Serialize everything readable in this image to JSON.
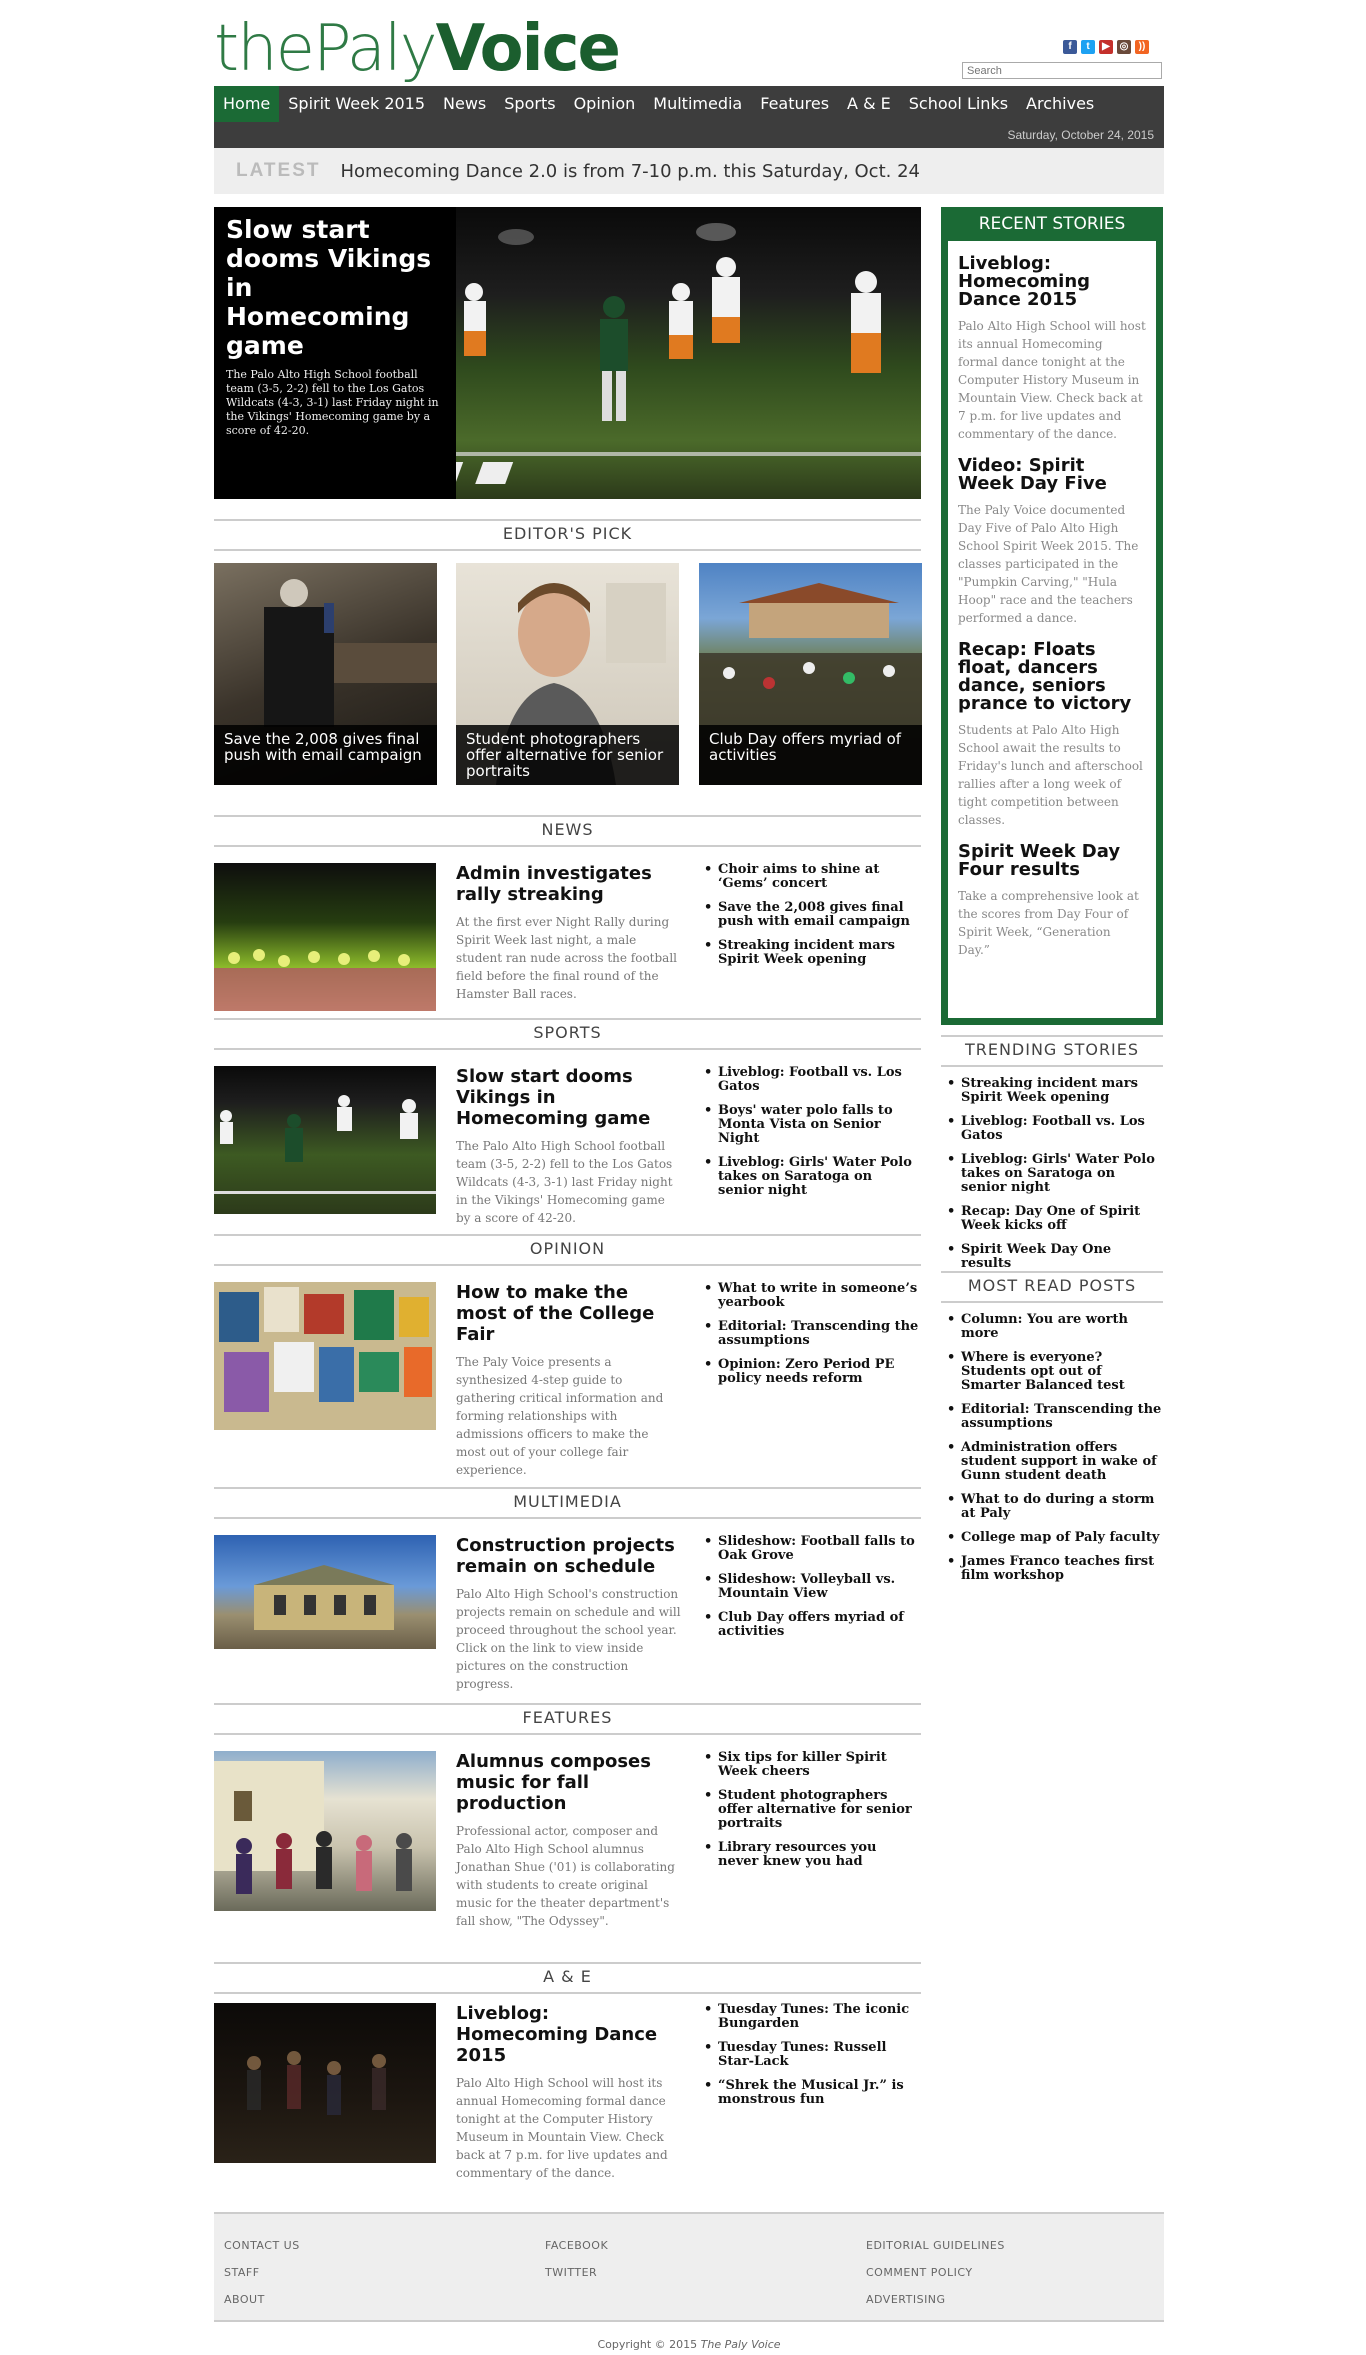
{
  "header": {
    "logo_part1": "thePaly",
    "logo_part2": "Voice",
    "search_placeholder": "Search",
    "social_icons": [
      "facebook-icon",
      "twitter-icon",
      "youtube-icon",
      "instagram-icon",
      "rss-icon"
    ]
  },
  "nav": {
    "items": [
      "Home",
      "Spirit Week 2015",
      "News",
      "Sports",
      "Opinion",
      "Multimedia",
      "Features",
      "A & E",
      "School Links",
      "Archives"
    ],
    "active": "Home",
    "date": "Saturday, October 24, 2015"
  },
  "latest": {
    "label": "LATEST",
    "text": "Homecoming Dance 2.0 is from 7-10 p.m. this Saturday, Oct. 24"
  },
  "hero": {
    "title": "Slow start dooms Vikings in Homecoming game",
    "summary": "The Palo Alto High School football team (3-5, 2-2) fell to the Los Gatos Wildcats (4-3, 3-1) last Friday night in the Vikings' Homecoming game by a score of 42-20."
  },
  "editors_pick": {
    "heading": "EDITOR'S PICK",
    "items": [
      "Save the 2,008 gives final push with email campaign",
      "Student photographers offer alternative for senior portraits",
      "Club Day offers myriad of activities"
    ]
  },
  "sections": [
    {
      "heading": "NEWS",
      "title": "Admin investigates rally streaking",
      "summary": "At the first ever Night Rally during Spirit Week last night, a male student ran nude across the football field before the final round of the Hamster Ball races.",
      "links": [
        "Choir aims to shine at ‘Gems’ concert",
        "Save the 2,008 gives final push with email campaign",
        "Streaking incident mars Spirit Week opening"
      ]
    },
    {
      "heading": "SPORTS",
      "title": "Slow start dooms Vikings in Homecoming game",
      "summary": "The Palo Alto High School football team (3-5, 2-2) fell to the Los Gatos Wildcats (4-3, 3-1) last Friday night in the Vikings' Homecoming game by a score of 42-20.",
      "links": [
        "Liveblog: Football vs. Los Gatos",
        "Boys' water polo falls to Monta Vista on Senior Night",
        "Liveblog: Girls' Water Polo takes on Saratoga on senior night"
      ]
    },
    {
      "heading": "OPINION",
      "title": "How to make the most of the College Fair",
      "summary": "The Paly Voice presents a synthesized 4-step guide to gathering critical information and forming relationships with admissions officers to make the most out of your college fair experience.",
      "links": [
        "What to write in someone’s yearbook",
        "Editorial: Transcending the assumptions",
        "Opinion: Zero Period PE policy needs reform"
      ]
    },
    {
      "heading": "MULTIMEDIA",
      "title": "Construction projects remain on schedule",
      "summary": "Palo Alto High School's construction projects remain on schedule and will proceed throughout the school year. Click on the link to view inside pictures on the construction progress.",
      "links": [
        "Slideshow: Football falls to Oak Grove",
        "Slideshow: Volleyball vs. Mountain View",
        "Club Day offers myriad of activities"
      ]
    },
    {
      "heading": "FEATURES",
      "title": "Alumnus composes music for fall production",
      "summary": "Professional actor, composer and Palo Alto High School alumnus Jonathan Shue ('01) is collaborating with students to create original music for the theater department's fall show, \"The Odyssey\".",
      "links": [
        "Six tips for killer Spirit Week cheers",
        "Student photographers offer alternative for senior portraits",
        "Library resources you never knew you had"
      ]
    },
    {
      "heading": "A & E",
      "title": "Liveblog: Homecoming Dance 2015",
      "summary": "Palo Alto High School will host its annual Homecoming formal dance tonight at the Computer History Museum in Mountain View. Check back at 7 p.m. for live updates and commentary of the dance.",
      "links": [
        "Tuesday Tunes: The iconic Bungarden",
        "Tuesday Tunes: Russell Star-Lack",
        "“Shrek the Musical Jr.” is monstrous fun"
      ]
    }
  ],
  "recent_stories": {
    "heading": "RECENT STORIES",
    "items": [
      {
        "title": "Liveblog: Homecoming Dance 2015",
        "summary": "Palo Alto High School will host its annual Homecoming formal dance tonight at the Computer History Museum in Mountain View. Check back at 7 p.m. for live updates and commentary of the dance."
      },
      {
        "title": "Video: Spirit Week Day Five",
        "summary": "The Paly Voice documented Day Five of Palo Alto High School Spirit Week 2015. The classes participated in the \"Pumpkin Carving,\" \"Hula Hoop\" race and the teachers performed a dance."
      },
      {
        "title": "Recap: Floats float, dancers dance, seniors prance to victory",
        "summary": "Students at Palo Alto High School await the results to Friday's lunch and afterschool rallies after a long week of tight competition between classes."
      },
      {
        "title": "Spirit Week Day Four results",
        "summary": "Take a comprehensive look at the scores from Day Four of Spirit Week, “Generation Day.”"
      }
    ]
  },
  "trending": {
    "heading": "TRENDING STORIES",
    "items": [
      "Streaking incident mars Spirit Week opening",
      "Liveblog: Football vs. Los Gatos",
      "Liveblog: Girls' Water Polo takes on Saratoga on senior night",
      "Recap: Day One of Spirit Week kicks off",
      "Spirit Week Day One results"
    ]
  },
  "most_read": {
    "heading": "MOST READ POSTS",
    "items": [
      "Column: You are worth more",
      "Where is everyone? Students opt out of Smarter Balanced test",
      "Editorial: Transcending the assumptions",
      "Administration offers student support in wake of Gunn student death",
      "What to do during a storm at Paly",
      "College map of Paly faculty",
      "James Franco teaches first film workshop"
    ]
  },
  "footer": {
    "col1": [
      "CONTACT US",
      "STAFF",
      "ABOUT"
    ],
    "col2": [
      "FACEBOOK",
      "TWITTER"
    ],
    "col3": [
      "EDITORIAL GUIDELINES",
      "COMMENT POLICY",
      "ADVERTISING"
    ],
    "copyright_prefix": "Copyright © 2015 ",
    "copyright_name": "The Paly Voice"
  },
  "colors": {
    "brand_green": "#1b6a35",
    "nav_bg": "#3d3d3d"
  }
}
